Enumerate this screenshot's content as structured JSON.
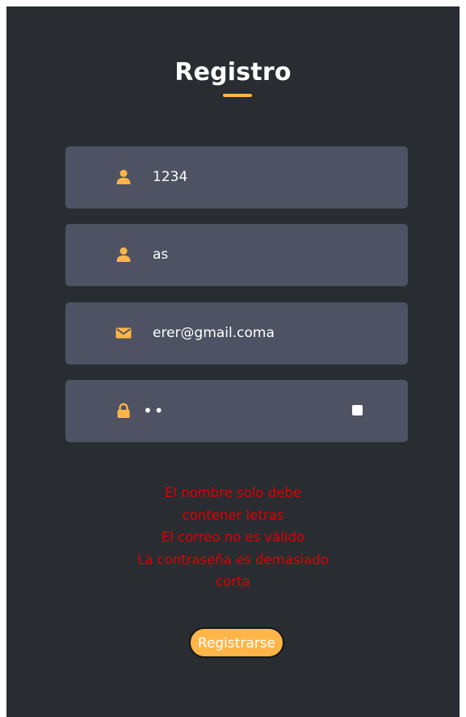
{
  "form": {
    "title": "Registro",
    "fields": [
      {
        "name": "username",
        "icon": "user-icon",
        "value": "1234"
      },
      {
        "name": "fullname",
        "icon": "user-icon",
        "value": "as"
      },
      {
        "name": "email",
        "icon": "envelope-icon",
        "value": "erer@gmail.coma"
      },
      {
        "name": "password",
        "icon": "lock-icon",
        "value": "••"
      }
    ],
    "errors": [
      "El nombre solo debe",
      "contener letras",
      "El correo no es válido",
      "La contraseña es demasiado",
      "corta"
    ],
    "submit_label": "Registrarse"
  },
  "colors": {
    "background": "#292c31",
    "field": "#4e5262",
    "accent": "#ffb547",
    "error": "#e10000"
  }
}
